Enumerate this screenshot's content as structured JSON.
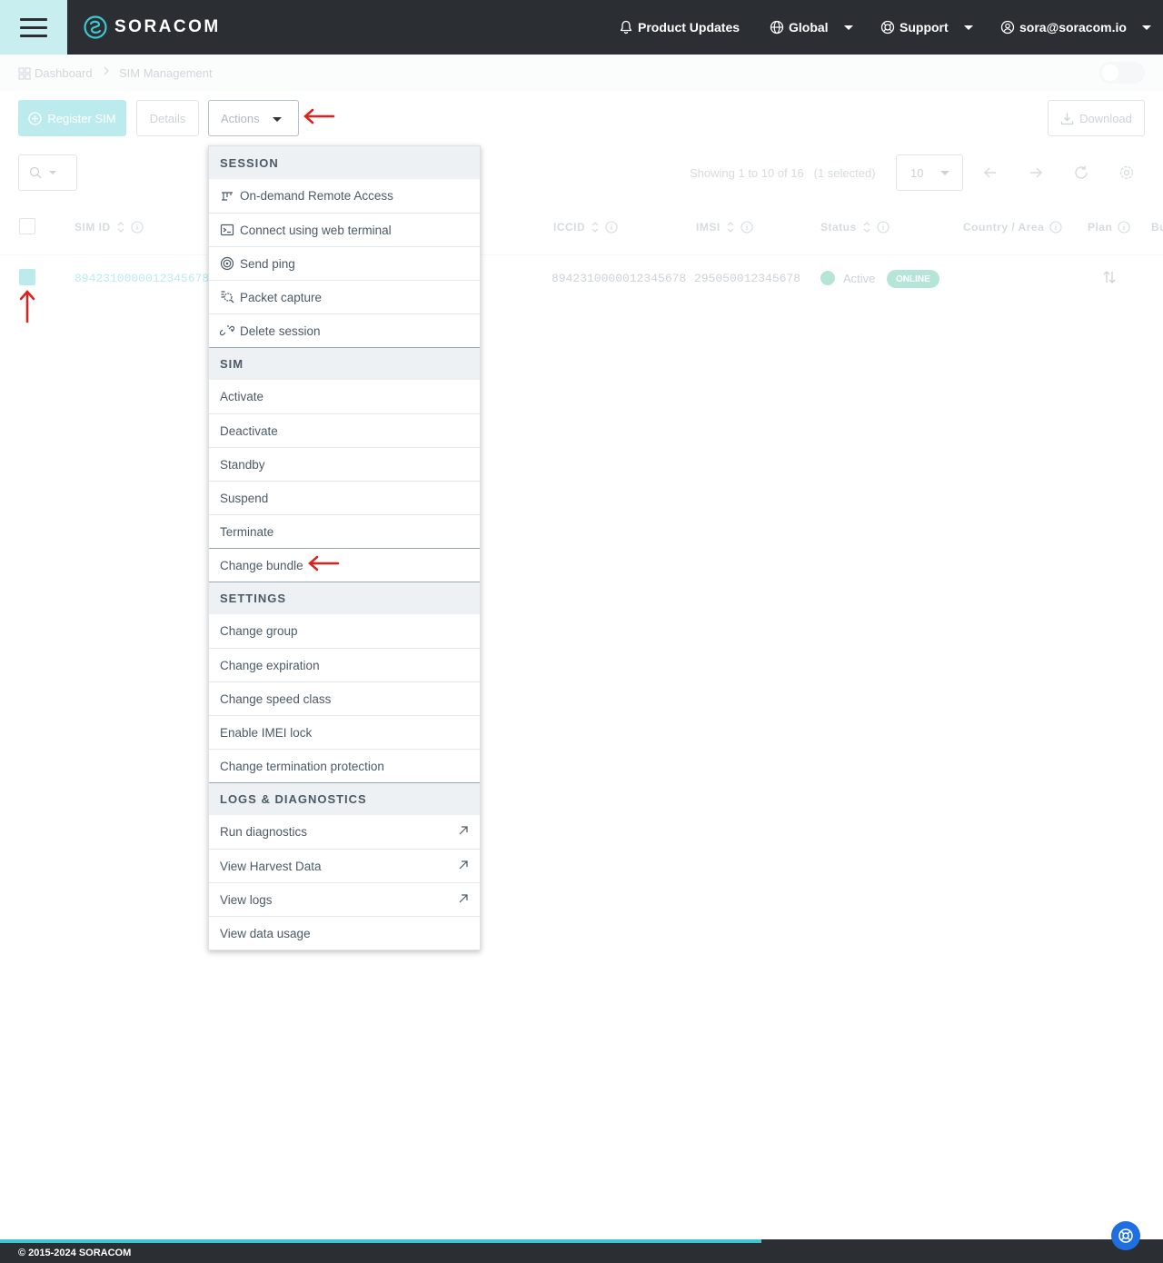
{
  "brand": {
    "name": "SORACOM"
  },
  "nav": {
    "product_updates": "Product Updates",
    "region": "Global",
    "support": "Support",
    "account": "sora@soracom.io"
  },
  "breadcrumb": {
    "dashboard": "Dashboard",
    "current": "SIM Management"
  },
  "toolbar": {
    "register_sim": "Register SIM",
    "details": "Details",
    "actions": "Actions",
    "download": "Download"
  },
  "pagination": {
    "showing": "Showing 1 to 10 of 16",
    "selected": "(1 selected)",
    "page_size": "10"
  },
  "table": {
    "columns": [
      "SIM ID",
      "ICCID",
      "IMSI",
      "Status",
      "Country / Area",
      "Plan",
      "Bu"
    ],
    "row": {
      "sim_id": "8942310000012345678",
      "iccid": "8942310000012345678",
      "imsi": "295050012345678",
      "status": "Active",
      "session": "ONLINE"
    }
  },
  "menu": {
    "session": {
      "header": "SESSION",
      "items": [
        "On-demand Remote Access",
        "Connect using web terminal",
        "Send ping",
        "Packet capture",
        "Delete session"
      ]
    },
    "sim": {
      "header": "SIM",
      "items": [
        "Activate",
        "Deactivate",
        "Standby",
        "Suspend",
        "Terminate",
        "Change bundle"
      ]
    },
    "settings": {
      "header": "SETTINGS",
      "items": [
        "Change group",
        "Change expiration",
        "Change speed class",
        "Enable IMEI lock",
        "Change termination protection"
      ]
    },
    "logs": {
      "header": "LOGS & DIAGNOSTICS",
      "items": [
        "Run diagnostics",
        "View Harvest Data",
        "View logs",
        "View data usage"
      ]
    }
  },
  "footer": {
    "copyright": "© 2015-2024 SORACOM"
  },
  "colors": {
    "navbar": "#2b2f33",
    "accent": "#3fc6cf",
    "online": "#2db58a",
    "annotation": "#e0201b"
  }
}
